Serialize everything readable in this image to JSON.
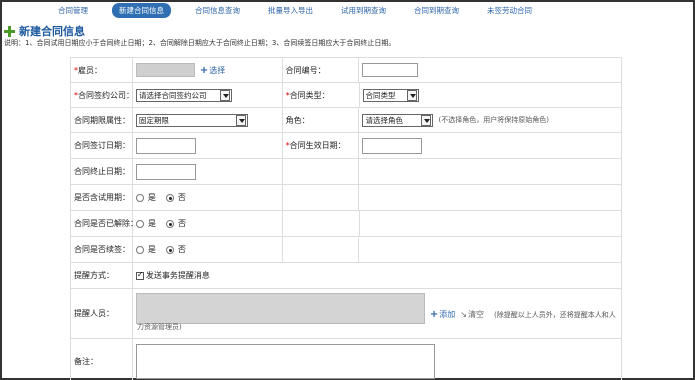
{
  "tabs": [
    {
      "label": "合同管理",
      "active": false
    },
    {
      "label": "新建合同信息",
      "active": true
    },
    {
      "label": "合同信息查询",
      "active": false
    },
    {
      "label": "批量导入导出",
      "active": false
    },
    {
      "label": "试用到期查询",
      "active": false
    },
    {
      "label": "合同到期查询",
      "active": false
    },
    {
      "label": "未签劳动合同",
      "active": false
    }
  ],
  "page_title": "新建合同信息",
  "note": "说明：1、合同试用日期应小于合同终止日期；2、合同解除日期应大于合同终止日期；3、合同续签日期应大于合同终止日期。",
  "form": {
    "employee_label": "雇员：",
    "employee_value": "",
    "select_link": "选择",
    "contract_no_label": "合同编号：",
    "company_label": "合同签约公司：",
    "company_select": "请选择合同签约公司",
    "contract_type_label": "合同类型：",
    "contract_type_select": "合同类型",
    "term_attr_label": "合同期限属性：",
    "term_attr_select": "固定期限",
    "role_label": "角色：",
    "role_select": "请选择角色",
    "role_hint": "(不选择角色，用户将保持原始角色)",
    "sign_date_label": "合同签订日期：",
    "effective_date_label": "合同生效日期：",
    "end_date_label": "合同终止日期：",
    "probation_label": "是否含试用期：",
    "terminated_label": "合同是否已解除：",
    "renewed_label": "合同是否续签：",
    "yes": "是",
    "no": "否",
    "reminder_method_label": "提醒方式：",
    "reminder_checkbox": "发送事务提醒消息",
    "reminder_checked": true,
    "reminder_people_label": "提醒人员：",
    "add_link": "添加",
    "clear_link": "清空",
    "reminder_hint": "(除提醒以上人员外，还将提醒本人和人",
    "reminder_hint_2": "力资源管理员)",
    "remark_label": "备注："
  }
}
